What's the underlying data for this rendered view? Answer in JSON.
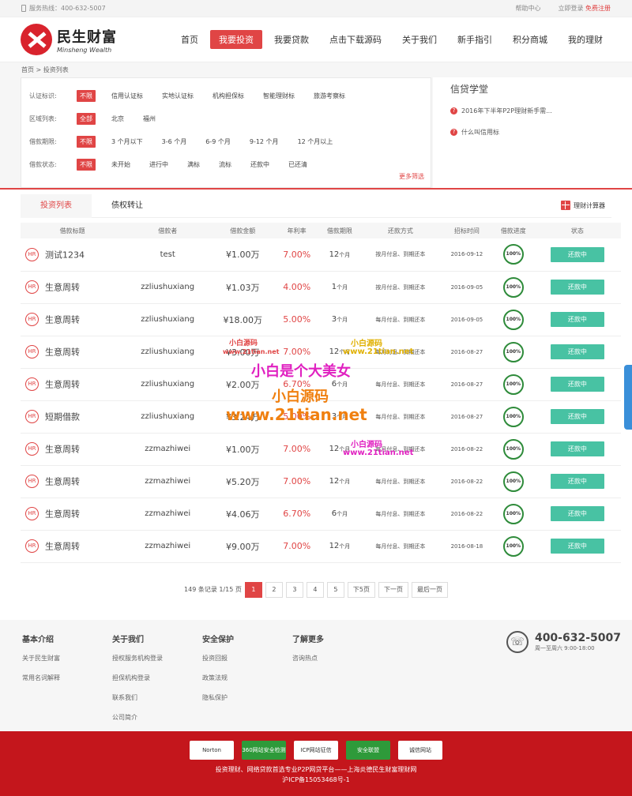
{
  "topbar": {
    "hotline": "服务热线：400-632-5007",
    "help": "帮助中心",
    "login": "立即登录",
    "register": "免费注册"
  },
  "logo": {
    "cn": "民生财富",
    "en": "Minsheng Wealth"
  },
  "nav": [
    "首页",
    "我要投资",
    "我要贷款",
    "点击下载源码",
    "关于我们",
    "新手指引",
    "积分商城",
    "我的理财"
  ],
  "breadcrumb": "首页 > 投资列表",
  "filters": [
    {
      "label": "认证标识:",
      "options": [
        "不限",
        "信用认证标",
        "实地认证标",
        "机构担保标",
        "智能理财标",
        "旅游考察标"
      ]
    },
    {
      "label": "区域列表:",
      "options": [
        "全部",
        "北京",
        "福州"
      ]
    },
    {
      "label": "借款期限:",
      "options": [
        "不限",
        "3 个月以下",
        "3-6 个月",
        "6-9 个月",
        "9-12 个月",
        "12 个月以上"
      ]
    },
    {
      "label": "借款状态:",
      "options": [
        "不限",
        "未开始",
        "进行中",
        "满标",
        "流标",
        "还款中",
        "已还清"
      ]
    }
  ],
  "more_filter": "更多筛选",
  "school": {
    "title": "信贷学堂",
    "items": [
      "2016年下半年P2P理财新手需...",
      "什么叫信用标"
    ]
  },
  "tabs": [
    "投资列表",
    "债权转让"
  ],
  "calculator": "理财计算器",
  "table": {
    "headers": [
      "借款标题",
      "借款者",
      "借款金额",
      "年利率",
      "借款期限",
      "还款方式",
      "招标时间",
      "借款进度",
      "状态"
    ],
    "rows": [
      {
        "title": "测试1234",
        "user": "test",
        "amount": "¥1.00万",
        "rate": "7.00%",
        "term": "12",
        "unit": "个月",
        "way": "按月付息、到期还本",
        "date": "2016-09-12",
        "progress": "100%",
        "status": "还款中"
      },
      {
        "title": "生意周转",
        "user": "zzliushuxiang",
        "amount": "¥1.03万",
        "rate": "4.00%",
        "term": "1",
        "unit": "个月",
        "way": "按月付息、到期还本",
        "date": "2016-09-05",
        "progress": "100%",
        "status": "还款中"
      },
      {
        "title": "生意周转",
        "user": "zzliushuxiang",
        "amount": "¥18.00万",
        "rate": "5.00%",
        "term": "3",
        "unit": "个月",
        "way": "每月付息、到期还本",
        "date": "2016-09-05",
        "progress": "100%",
        "status": "还款中"
      },
      {
        "title": "生意周转",
        "user": "zzliushuxiang",
        "amount": "¥3.00万",
        "rate": "7.00%",
        "term": "12",
        "unit": "个月",
        "way": "每月付息、到期还本",
        "date": "2016-08-27",
        "progress": "100%",
        "status": "还款中"
      },
      {
        "title": "生意周转",
        "user": "zzliushuxiang",
        "amount": "¥2.00万",
        "rate": "6.70%",
        "term": "6",
        "unit": "个月",
        "way": "每月付息、到期还本",
        "date": "2016-08-27",
        "progress": "100%",
        "status": "还款中"
      },
      {
        "title": "短期借款",
        "user": "zzliushuxiang",
        "amount": "¥3.24万",
        "rate": "5.00%",
        "term": "3",
        "unit": "个月",
        "way": "每月付息、到期还本",
        "date": "2016-08-27",
        "progress": "100%",
        "status": "还款中"
      },
      {
        "title": "生意周转",
        "user": "zzmazhiwei",
        "amount": "¥1.00万",
        "rate": "7.00%",
        "term": "12",
        "unit": "个月",
        "way": "每月付息、到期还本",
        "date": "2016-08-22",
        "progress": "100%",
        "status": "还款中"
      },
      {
        "title": "生意周转",
        "user": "zzmazhiwei",
        "amount": "¥5.20万",
        "rate": "7.00%",
        "term": "12",
        "unit": "个月",
        "way": "每月付息、到期还本",
        "date": "2016-08-22",
        "progress": "100%",
        "status": "还款中"
      },
      {
        "title": "生意周转",
        "user": "zzmazhiwei",
        "amount": "¥4.06万",
        "rate": "6.70%",
        "term": "6",
        "unit": "个月",
        "way": "每月付息、到期还本",
        "date": "2016-08-22",
        "progress": "100%",
        "status": "还款中"
      },
      {
        "title": "生意周转",
        "user": "zzmazhiwei",
        "amount": "¥9.00万",
        "rate": "7.00%",
        "term": "12",
        "unit": "个月",
        "way": "每月付息、到期还本",
        "date": "2016-08-18",
        "progress": "100%",
        "status": "还款中"
      }
    ]
  },
  "pager": {
    "info": "149 条记录 1/15 页",
    "pages": [
      "1",
      "2",
      "3",
      "4",
      "5"
    ],
    "next5": "下5页",
    "next": "下一页",
    "last": "最后一页"
  },
  "footer": {
    "cols": [
      {
        "title": "基本介绍",
        "items": [
          "关于民生财富",
          "常用名词解释"
        ]
      },
      {
        "title": "关于我们",
        "items": [
          "授权服务机构登录",
          "担保机构登录",
          "联系我们",
          "公司简介"
        ]
      },
      {
        "title": "安全保护",
        "items": [
          "投资回报",
          "政策法规",
          "隐私保护"
        ]
      },
      {
        "title": "了解更多",
        "items": [
          "咨询热点"
        ]
      }
    ],
    "phone": "400-632-5007",
    "time": "周一至周六 9:00-18:00"
  },
  "bottom": {
    "badges": [
      "Norton",
      "360网站安全检测",
      "ICP网站征信",
      "安全联盟",
      "诚信网站"
    ],
    "line1": "投资理财、网络贷款首选专业P2P网贷平台——上海炎德民生财富理财网",
    "line2": "沪ICP备15053468号-1"
  },
  "watermarks": [
    "小白源码",
    "www.21tian.net",
    "小白是个大美女",
    "小白源码",
    "www.21tian.net",
    "小白源码",
    "www.21tian.net",
    "小白源码",
    "www.21tian.net"
  ],
  "colors": {
    "accent": "#e04545",
    "status_btn": "#48c2a3",
    "progress": "#2e8b3a",
    "footer_red": "#c4161c"
  }
}
